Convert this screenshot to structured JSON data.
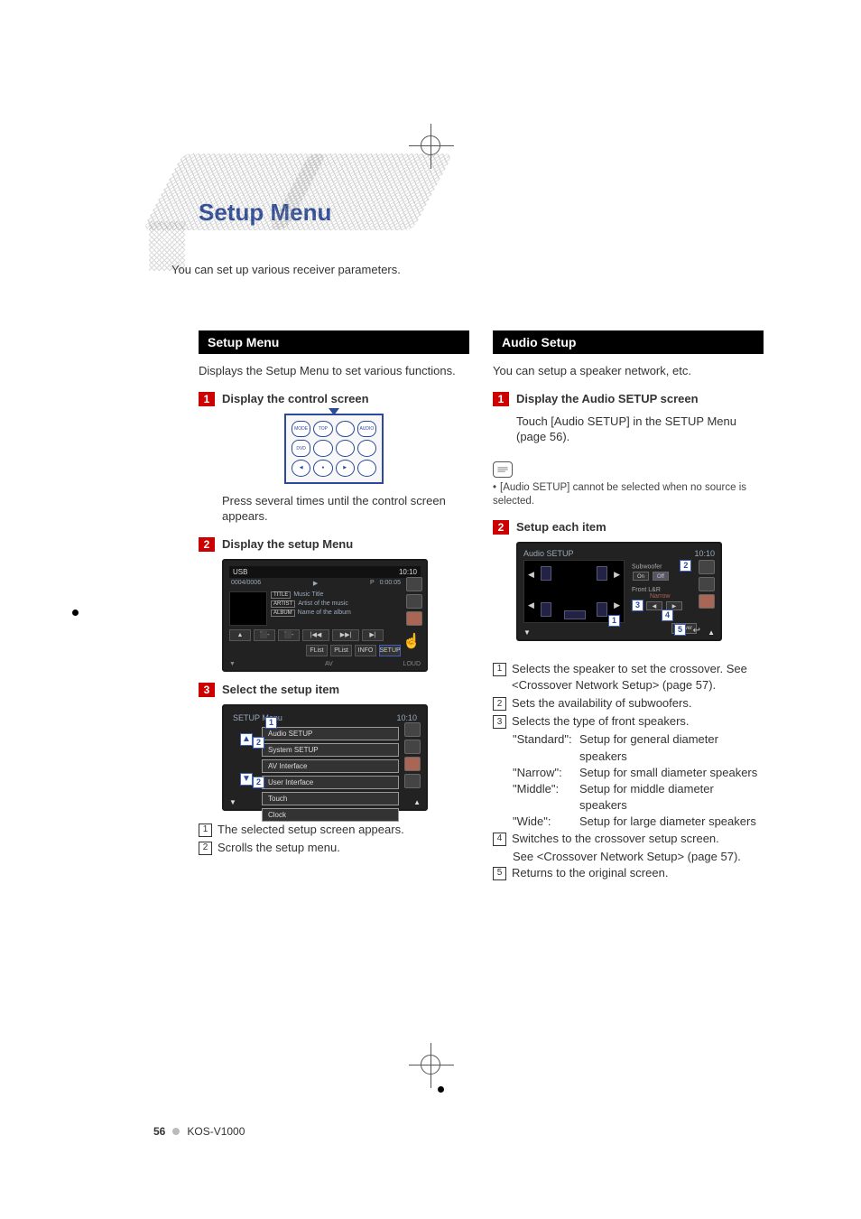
{
  "page_title": "Setup Menu",
  "intro": "You can set up various receiver parameters.",
  "footer": {
    "page": "56",
    "model": "KOS-V1000"
  },
  "left": {
    "section_title": "Setup Menu",
    "section_desc": "Displays the Setup Menu to set various functions.",
    "steps": {
      "s1": {
        "num": "1",
        "title": "Display the control screen",
        "body": "Press several times until the control screen appears."
      },
      "s2": {
        "num": "2",
        "title": "Display the setup Menu"
      },
      "s3": {
        "num": "3",
        "title": "Select the setup item"
      }
    },
    "remote_buttons": [
      "MODE",
      "TOP M",
      "AUDIO",
      "",
      "DVD",
      "",
      "",
      "",
      "",
      "",
      "",
      ""
    ],
    "usb": {
      "title": "USB",
      "time_r": "10:10",
      "counter": "0004/0006",
      "play_icon": "▶",
      "p": "P",
      "elapsed": "0:00:05",
      "title_tag": "TITLE",
      "title_val": "Music Title",
      "artist_tag": "ARTIST",
      "artist_val": "Artist of the music",
      "album_tag": "ALBUM",
      "album_val": "Name of the album",
      "transport": [
        "▲",
        "⬛-",
        "⬛-",
        "|◀◀",
        "▶▶|",
        "▶|"
      ],
      "transport2": [
        "FList",
        "PList",
        "INFO",
        "SETUP"
      ],
      "bl": "▼",
      "br_l": "AV",
      "br_r": "LOUD"
    },
    "setup_menu": {
      "title": "SETUP Menu",
      "time": "10:10",
      "items": [
        "Audio SETUP",
        "System SETUP",
        "AV Interface",
        "User Interface",
        "Touch",
        "Clock"
      ]
    },
    "callouts": {
      "c1": "The selected setup screen appears.",
      "c2": "Scrolls the setup menu."
    }
  },
  "right": {
    "section_title": "Audio Setup",
    "section_desc": "You can setup a speaker network, etc.",
    "steps": {
      "s1": {
        "num": "1",
        "title": "Display the Audio SETUP screen",
        "body": "Touch [Audio SETUP] in the SETUP Menu (page 56)."
      },
      "s2": {
        "num": "2",
        "title": "Setup each item"
      }
    },
    "note": "[Audio SETUP] cannot be selected when no source is selected.",
    "audio_fig": {
      "title": "Audio SETUP",
      "time": "10:10",
      "sub_label": "Subwoofer",
      "sub_on": "On",
      "sub_off": "Off",
      "front_label": "Front L&R",
      "front_val": "Narrow",
      "xover": "X'Over"
    },
    "callouts": {
      "c1": "Selects the speaker to set the crossover. See <Crossover Network Setup> (page 57).",
      "c2": "Sets the availability of subwoofers.",
      "c3": "Selects the type of front speakers.",
      "c3_standard_k": "\"Standard\":",
      "c3_standard_v": "Setup for general diameter speakers",
      "c3_narrow_k": "\"Narrow\":",
      "c3_narrow_v": "Setup for small diameter speakers",
      "c3_middle_k": "\"Middle\":",
      "c3_middle_v": "Setup for middle diameter speakers",
      "c3_wide_k": "\"Wide\":",
      "c3_wide_v": "Setup for large diameter speakers",
      "c4a": "Switches to the crossover setup screen.",
      "c4b": "See <Crossover Network Setup> (page 57).",
      "c5": "Returns to the original screen."
    }
  }
}
